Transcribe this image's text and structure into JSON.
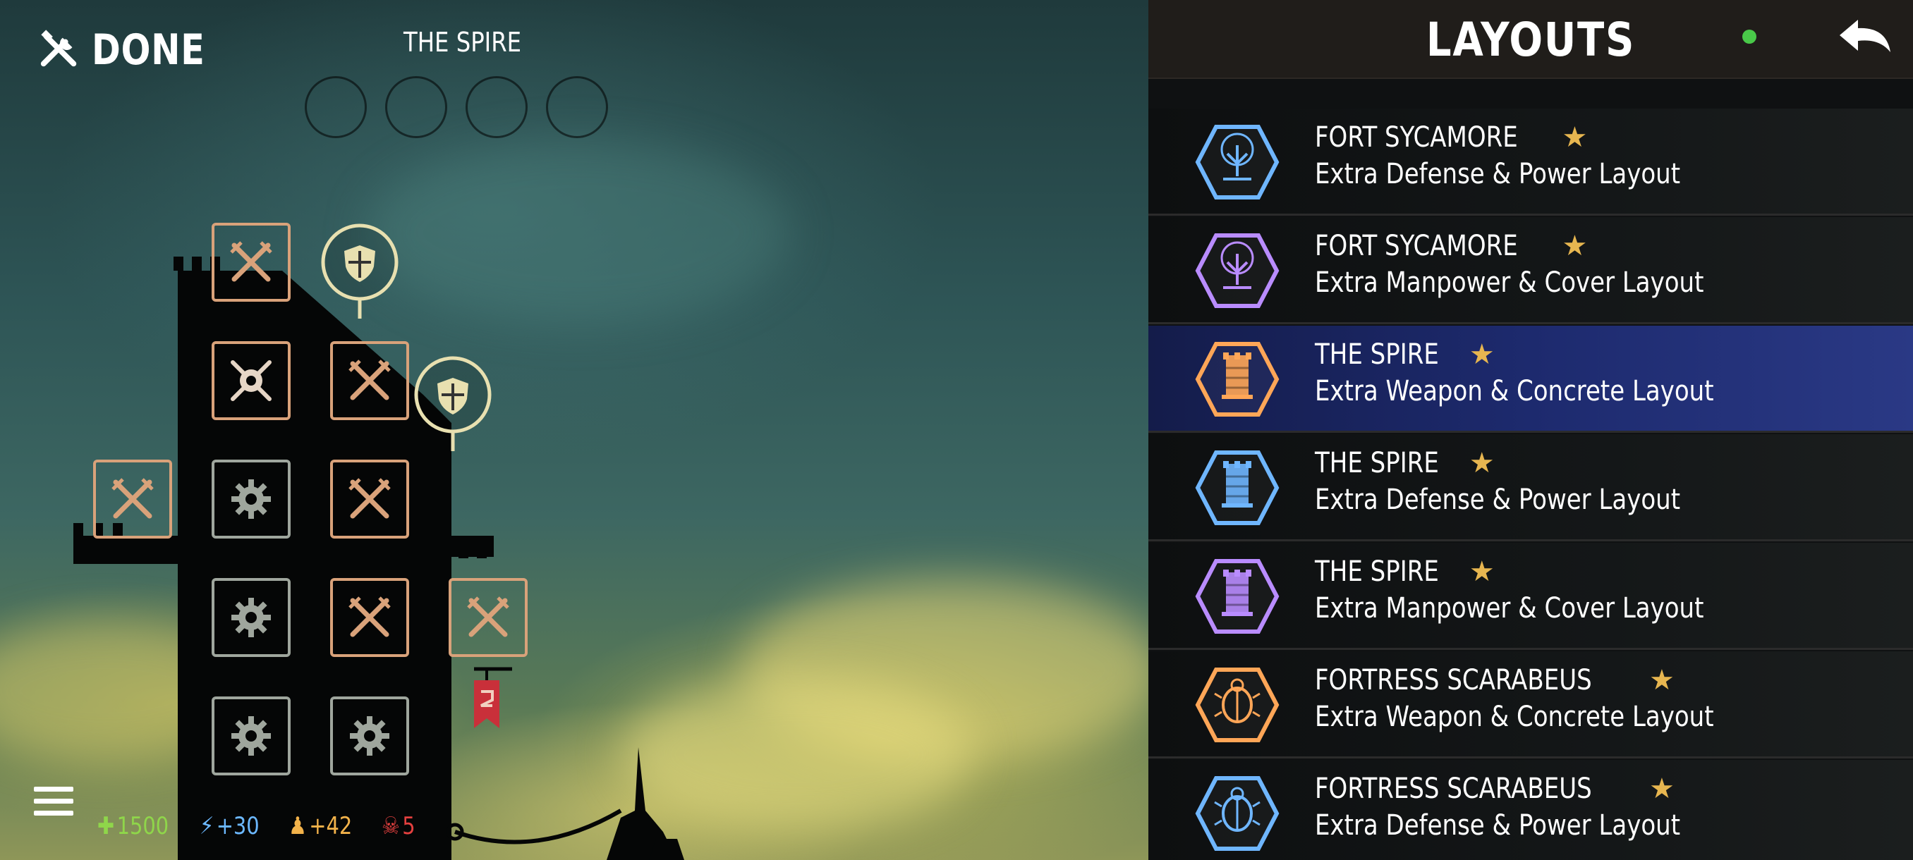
{
  "header": {
    "done_label": "DONE",
    "layout_name": "THE SPIRE"
  },
  "resources": {
    "health": "1500",
    "power": "+30",
    "manpower": "+42",
    "threat": "5"
  },
  "panel": {
    "title": "LAYOUTS",
    "items": [
      {
        "name": "FORT SYCAMORE",
        "desc": "Extra Defense & Power Layout",
        "color": "#6fb6ff",
        "icon": "tree-icon",
        "selected": false
      },
      {
        "name": "FORT SYCAMORE",
        "desc": "Extra Manpower & Cover Layout",
        "color": "#b98cff",
        "icon": "tree-icon",
        "selected": false
      },
      {
        "name": "THE SPIRE",
        "desc": "Extra Weapon & Concrete Layout",
        "color": "#ffa657",
        "icon": "tower-icon",
        "selected": true
      },
      {
        "name": "THE SPIRE",
        "desc": "Extra Defense & Power Layout",
        "color": "#6fb6ff",
        "icon": "tower-icon",
        "selected": false
      },
      {
        "name": "THE SPIRE",
        "desc": "Extra Manpower & Cover Layout",
        "color": "#b98cff",
        "icon": "tower-icon",
        "selected": false
      },
      {
        "name": "FORTRESS SCARABEUS",
        "desc": "Extra Weapon & Concrete Layout",
        "color": "#ffa657",
        "icon": "scarab-icon",
        "selected": false
      },
      {
        "name": "FORTRESS SCARABEUS",
        "desc": "Extra Defense & Power Layout",
        "color": "#6fb6ff",
        "icon": "scarab-icon",
        "selected": false
      }
    ]
  },
  "colors": {
    "accent_weapon": "#d9a27a",
    "accent_engine": "#9fa69d",
    "status_online": "#49c949",
    "selected_row": "#1d2a6e",
    "star": "#e7b650"
  }
}
